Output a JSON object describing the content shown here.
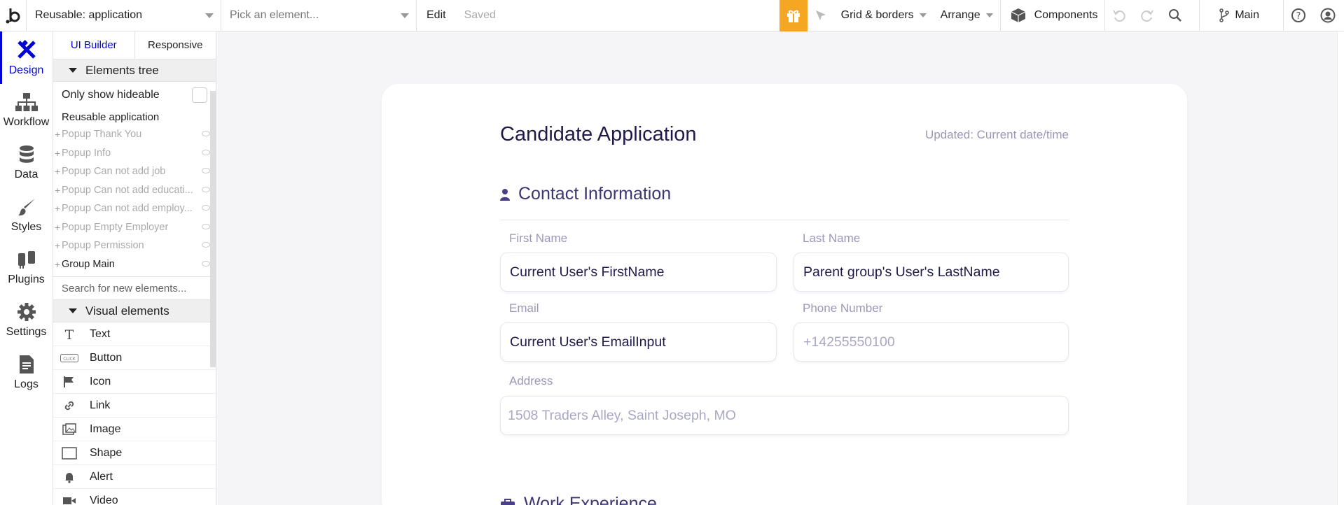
{
  "topbar": {
    "page_dropdown": "Reusable: application",
    "element_dropdown": "Pick an element...",
    "edit": "Edit",
    "saved": "Saved",
    "grid": "Grid & borders",
    "arrange": "Arrange",
    "components": "Components",
    "branch": "Main"
  },
  "leftnav": {
    "items": [
      {
        "label": "Design",
        "icon": "design-icon"
      },
      {
        "label": "Workflow",
        "icon": "workflow-icon"
      },
      {
        "label": "Data",
        "icon": "database-icon"
      },
      {
        "label": "Styles",
        "icon": "brush-icon"
      },
      {
        "label": "Plugins",
        "icon": "plug-icon"
      },
      {
        "label": "Settings",
        "icon": "gear-icon"
      },
      {
        "label": "Logs",
        "icon": "document-icon"
      }
    ]
  },
  "panel": {
    "tab_builder": "UI Builder",
    "tab_responsive": "Responsive",
    "elements_tree": "Elements tree",
    "only_hideable": "Only show hideable",
    "root": "Reusable application",
    "tree": [
      "Popup Thank You",
      "Popup Info",
      "Popup Can not add job",
      "Popup Can not add educati...",
      "Popup Can not add employ...",
      "Popup Empty Employer",
      "Popup Permission",
      "Group Main"
    ],
    "search_placeholder": "Search for new elements...",
    "visual_elements": "Visual elements",
    "visual": [
      {
        "label": "Text",
        "icon": "text-icon"
      },
      {
        "label": "Button",
        "icon": "button-icon"
      },
      {
        "label": "Icon",
        "icon": "flag-icon"
      },
      {
        "label": "Link",
        "icon": "link-icon"
      },
      {
        "label": "Image",
        "icon": "image-icon"
      },
      {
        "label": "Shape",
        "icon": "shape-icon"
      },
      {
        "label": "Alert",
        "icon": "bell-icon"
      },
      {
        "label": "Video",
        "icon": "video-icon"
      }
    ]
  },
  "form": {
    "title": "Candidate Application",
    "updated": "Updated: Current date/time",
    "contact_section": "Contact Information",
    "first_name_label": "First Name",
    "first_name_value": "Current User's FirstName",
    "last_name_label": "Last Name",
    "last_name_value": "Parent group's User's LastName",
    "email_label": "Email",
    "email_value": "Current User's EmailInput",
    "phone_label": "Phone Number",
    "phone_placeholder": "+14255550100",
    "address_label": "Address",
    "address_placeholder": "1508 Traders Alley, Saint Joseph, MO",
    "work_section": "Work Experience"
  },
  "colors": {
    "accent": "#0205d3",
    "gift": "#f5a623",
    "form_title": "#1e1b4b",
    "label": "#9a98b8"
  }
}
